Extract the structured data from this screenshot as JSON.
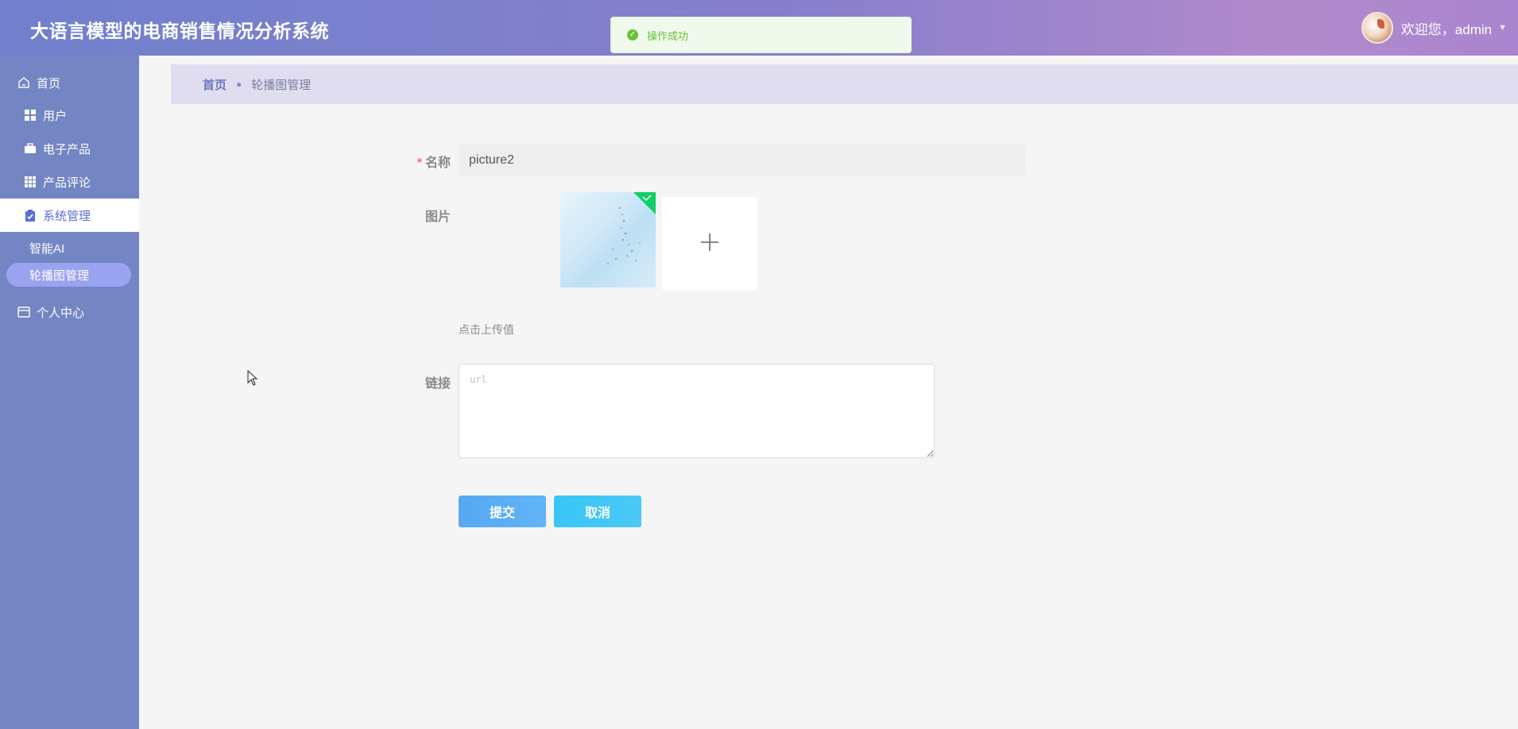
{
  "header": {
    "title": "大语言模型的电商销售情况分析系统",
    "welcome": "欢迎您，admin"
  },
  "toast": {
    "message": "操作成功",
    "color": "#67c23a"
  },
  "sidebar": {
    "items": [
      {
        "label": "首页",
        "icon": "home-icon"
      },
      {
        "label": "用户",
        "icon": "grid-icon"
      },
      {
        "label": "电子产品",
        "icon": "briefcase-icon"
      },
      {
        "label": "产品评论",
        "icon": "table-icon"
      },
      {
        "label": "系统管理",
        "icon": "clipboard-check-icon"
      }
    ],
    "sub_items": [
      {
        "label": "智能AI"
      },
      {
        "label": "轮播图管理"
      }
    ],
    "personal": {
      "label": "个人中心",
      "icon": "card-icon"
    }
  },
  "breadcrumb": {
    "home": "首页",
    "current": "轮播图管理"
  },
  "form": {
    "name_label": "名称",
    "name_value": "picture2",
    "image_label": "图片",
    "upload_hint": "点击上传值",
    "link_label": "链接",
    "link_placeholder": "url",
    "submit_label": "提交",
    "cancel_label": "取消"
  },
  "colors": {
    "sidebar_bg": "#7485c3",
    "active_text": "#5a6fd6",
    "submit_button": "#56a8f2",
    "cancel_button": "#37c6f6"
  }
}
